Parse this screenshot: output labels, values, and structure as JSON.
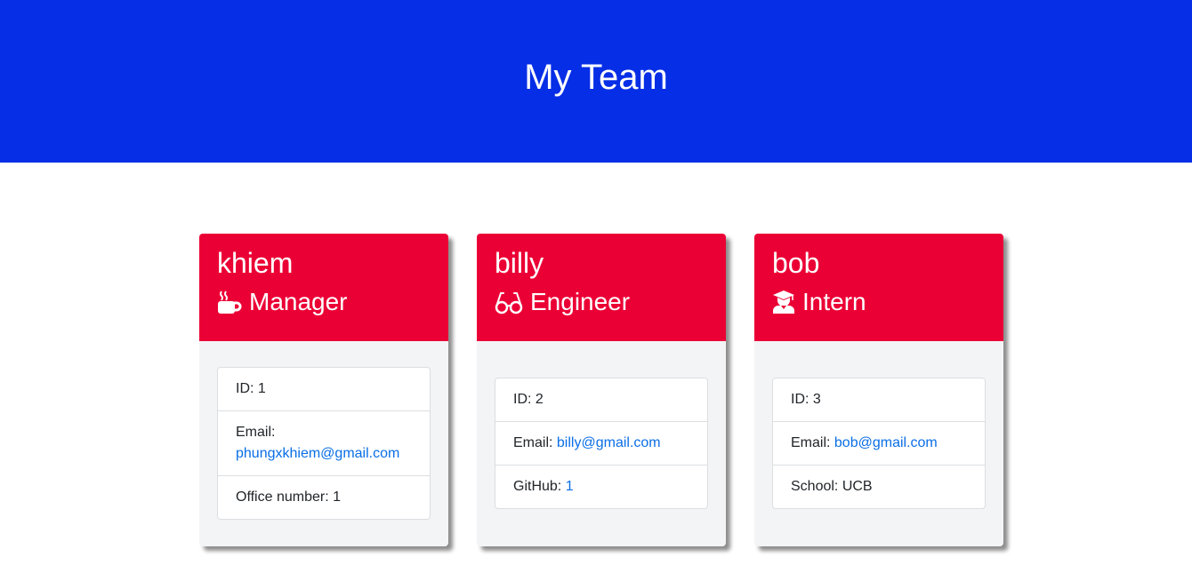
{
  "header": {
    "title": "My Team"
  },
  "colors": {
    "header_bg": "#062ee6",
    "card_header_bg": "#eb0035",
    "link": "#0a6ee6"
  },
  "team": [
    {
      "name": "khiem",
      "role": "Manager",
      "icon": "coffee-mug-icon",
      "id_label": "ID: 1",
      "email_label": "Email:",
      "email": "phungxkhiem@gmail.com",
      "extra_label": "Office number: 1"
    },
    {
      "name": "billy",
      "role": "Engineer",
      "icon": "glasses-icon",
      "id_label": "ID: 2",
      "email_label": "Email:",
      "email": "billy@gmail.com",
      "extra_label": "GitHub:",
      "extra_link": "1"
    },
    {
      "name": "bob",
      "role": "Intern",
      "icon": "graduate-icon",
      "id_label": "ID: 3",
      "email_label": "Email:",
      "email": "bob@gmail.com",
      "extra_label": "School: UCB"
    }
  ]
}
